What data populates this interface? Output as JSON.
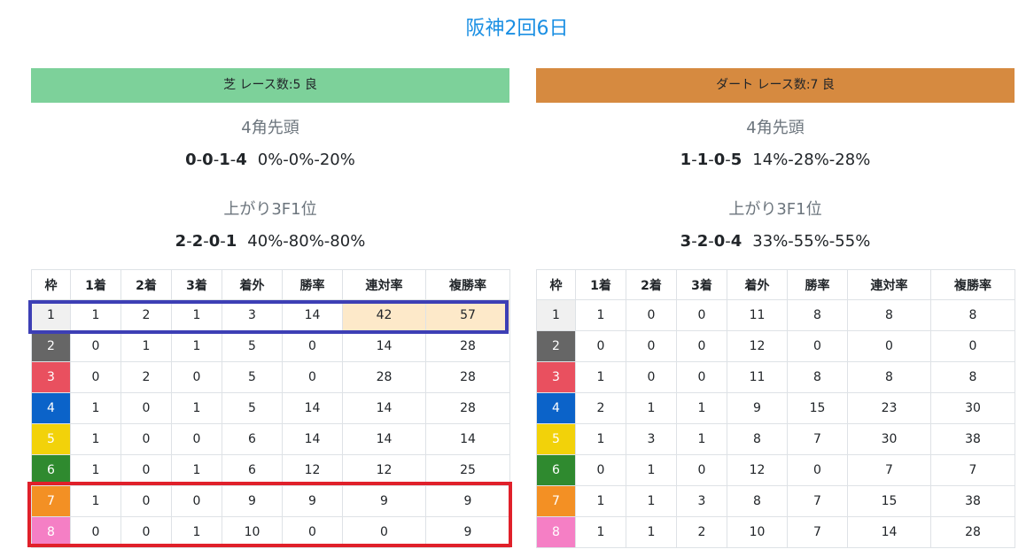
{
  "page_title": "阪神2回6日",
  "columns_header": [
    "枠",
    "1着",
    "2着",
    "3着",
    "着外",
    "勝率",
    "連対率",
    "複勝率"
  ],
  "waku_colors": {
    "1": "#f0f0f0",
    "2": "#666666",
    "3": "#e9505f",
    "4": "#0b63c9",
    "5": "#f2d20a",
    "6": "#2f8a2f",
    "7": "#f39024",
    "8": "#f57fc5"
  },
  "turf": {
    "header": "芝 レース数:5  良",
    "bar_color": "#7dd19a",
    "corner4_label": "4角先頭",
    "corner4_record": [
      "0",
      "0",
      "1",
      "4"
    ],
    "corner4_pct": "0%-0%-20%",
    "last3f_label": "上がり3F1位",
    "last3f_record": [
      "2",
      "2",
      "0",
      "1"
    ],
    "last3f_pct": "40%-80%-80%",
    "rows": [
      [
        "1",
        "1",
        "2",
        "1",
        "3",
        "14",
        "42",
        "57"
      ],
      [
        "2",
        "0",
        "1",
        "1",
        "5",
        "0",
        "14",
        "28"
      ],
      [
        "3",
        "0",
        "2",
        "0",
        "5",
        "0",
        "28",
        "28"
      ],
      [
        "4",
        "1",
        "0",
        "1",
        "5",
        "14",
        "14",
        "28"
      ],
      [
        "5",
        "1",
        "0",
        "0",
        "6",
        "14",
        "14",
        "14"
      ],
      [
        "6",
        "1",
        "0",
        "1",
        "6",
        "12",
        "12",
        "25"
      ],
      [
        "7",
        "1",
        "0",
        "0",
        "9",
        "9",
        "9",
        "9"
      ],
      [
        "8",
        "0",
        "0",
        "1",
        "10",
        "0",
        "0",
        "9"
      ]
    ]
  },
  "dirt": {
    "header": "ダート レース数:7  良",
    "bar_color": "#d68a40",
    "corner4_label": "4角先頭",
    "corner4_record": [
      "1",
      "1",
      "0",
      "5"
    ],
    "corner4_pct": "14%-28%-28%",
    "last3f_label": "上がり3F1位",
    "last3f_record": [
      "3",
      "2",
      "0",
      "4"
    ],
    "last3f_pct": "33%-55%-55%",
    "rows": [
      [
        "1",
        "1",
        "0",
        "0",
        "11",
        "8",
        "8",
        "8"
      ],
      [
        "2",
        "0",
        "0",
        "0",
        "12",
        "0",
        "0",
        "0"
      ],
      [
        "3",
        "1",
        "0",
        "0",
        "11",
        "8",
        "8",
        "8"
      ],
      [
        "4",
        "2",
        "1",
        "1",
        "9",
        "15",
        "23",
        "30"
      ],
      [
        "5",
        "1",
        "3",
        "1",
        "8",
        "7",
        "30",
        "38"
      ],
      [
        "6",
        "0",
        "1",
        "0",
        "12",
        "0",
        "7",
        "7"
      ],
      [
        "7",
        "1",
        "1",
        "3",
        "8",
        "7",
        "15",
        "38"
      ],
      [
        "8",
        "1",
        "1",
        "2",
        "10",
        "7",
        "14",
        "28"
      ]
    ]
  }
}
